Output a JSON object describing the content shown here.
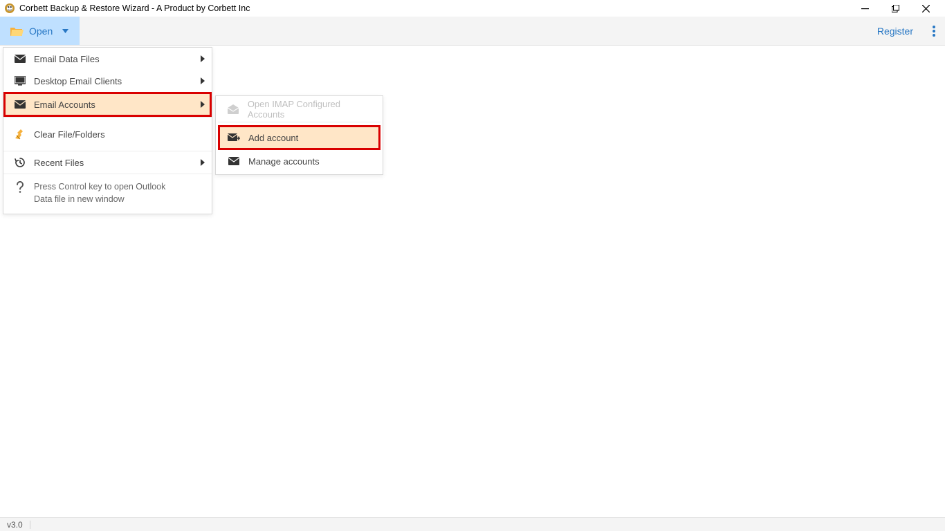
{
  "window": {
    "title": "Corbett Backup & Restore Wizard - A Product by Corbett Inc"
  },
  "toolbar": {
    "open_label": "Open",
    "register_label": "Register"
  },
  "menu": {
    "items": [
      {
        "label": "Email Data Files"
      },
      {
        "label": "Desktop Email Clients"
      },
      {
        "label": "Email Accounts"
      },
      {
        "label": "Clear File/Folders"
      },
      {
        "label": "Recent Files"
      }
    ],
    "help": "Press Control key to open Outlook Data file in new window"
  },
  "submenu": {
    "items": [
      {
        "label": "Open IMAP Configured Accounts"
      },
      {
        "label": "Add account"
      },
      {
        "label": "Manage accounts"
      }
    ]
  },
  "statusbar": {
    "version": "v3.0"
  }
}
